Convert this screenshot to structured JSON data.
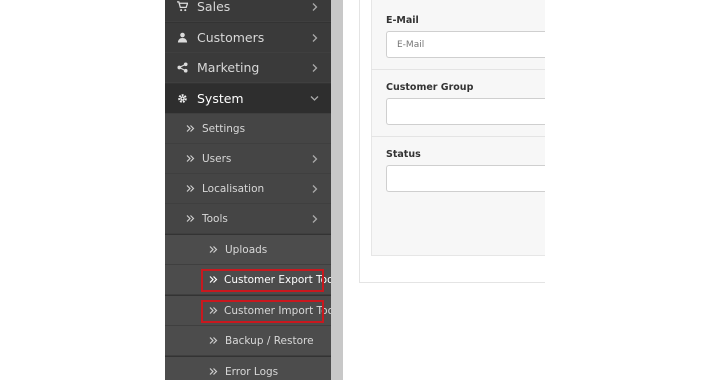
{
  "sidebar": {
    "items": [
      {
        "label": "Sales",
        "icon": "shopping-cart-icon"
      },
      {
        "label": "Customers",
        "icon": "user-icon"
      },
      {
        "label": "Marketing",
        "icon": "share-icon"
      },
      {
        "label": "System",
        "icon": "gear-icon"
      }
    ],
    "system_children": [
      {
        "label": "Settings"
      },
      {
        "label": "Users"
      },
      {
        "label": "Localisation"
      },
      {
        "label": "Tools"
      }
    ],
    "tools_children": [
      {
        "label": "Uploads"
      },
      {
        "label": "Customer Export Tool"
      },
      {
        "label": "Customer Import Tool"
      },
      {
        "label": "Backup / Restore"
      },
      {
        "label": "Error Logs"
      }
    ]
  },
  "form": {
    "email": {
      "label": "E-Mail",
      "placeholder": "E-Mail",
      "value": ""
    },
    "customer_group": {
      "label": "Customer Group",
      "value": ""
    },
    "status": {
      "label": "Status",
      "value": ""
    }
  },
  "colors": {
    "sidebar_bg": "#333333",
    "highlight": "#c9181e"
  }
}
